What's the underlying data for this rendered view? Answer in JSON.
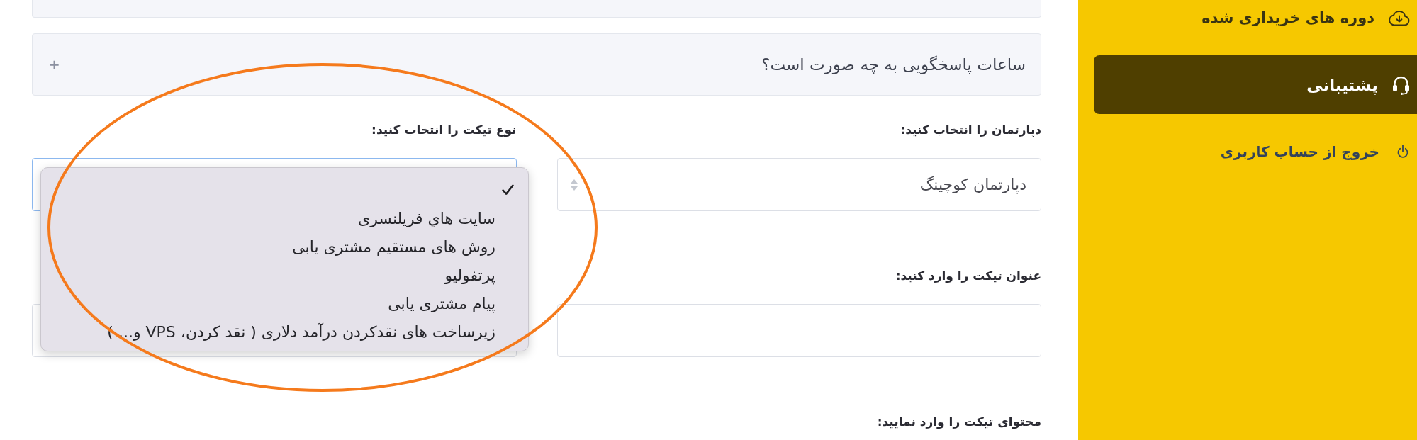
{
  "sidebar": {
    "items": [
      {
        "kind": "nav",
        "label": "دوره های خریداری شده",
        "selected": false
      },
      {
        "kind": "nav",
        "label": "پشتیبانی",
        "selected": true
      },
      {
        "kind": "logout",
        "label": "خروج از حساب کاربری",
        "selected": false
      }
    ]
  },
  "faq": {
    "items": [
      {
        "question": "ساعات پاسخگویی به چه صورت است؟",
        "toggle": "+"
      }
    ]
  },
  "form": {
    "fields": [
      {
        "kind": "select",
        "label": "دپارتمان را انتخاب کنید:",
        "value": "دپارتمان کوچینگ",
        "focused": false,
        "open": false
      },
      {
        "kind": "select",
        "label": "نوع تیکت را انتخاب کنید:",
        "focused": true,
        "open": true,
        "options": [
          {
            "selected": true
          },
          {
            "label": "سایت هاي فريلنسری",
            "selected": false
          },
          {
            "label": "روش های مستقیم مشتری یابی",
            "selected": false
          },
          {
            "label": "پرتفولیو",
            "selected": false
          },
          {
            "label": "پیام مشتری یابی",
            "selected": false
          },
          {
            "label": "زیرساخت های نقدکردن درآمد دلاری ( نقد کردن، VPS و... )",
            "selected": false
          }
        ]
      },
      {
        "kind": "text",
        "label": "عنوان تیکت را وارد کنید:"
      },
      {
        "kind": "text"
      },
      {
        "kind": "textarea",
        "label": "محتوای تیکت را وارد نمایید:"
      }
    ]
  },
  "annotations": [
    {
      "kind": "ellipse"
    }
  ]
}
